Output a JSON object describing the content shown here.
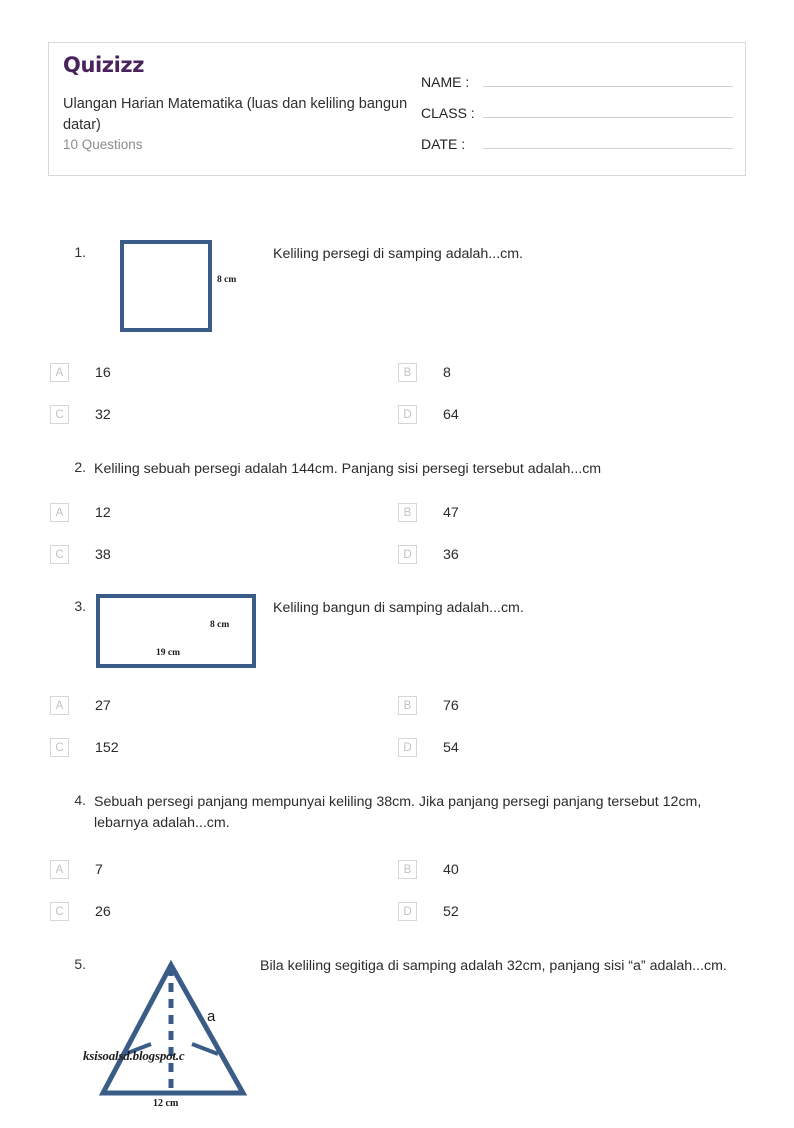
{
  "header": {
    "logo_text": "Quizizz",
    "quiz_title": "Ulangan Harian Matematika (luas dan keliling bangun datar)",
    "question_count": "10 Questions",
    "fields": [
      {
        "label": "NAME :",
        "value": ""
      },
      {
        "label": "CLASS :",
        "value": ""
      },
      {
        "label": "DATE  :",
        "value": ""
      }
    ]
  },
  "questions": [
    {
      "number": "1.",
      "text": "Keliling persegi di samping adalah...cm.",
      "figure": {
        "type": "square",
        "side_label": "8 cm"
      },
      "options": [
        {
          "letter": "A",
          "text": "16"
        },
        {
          "letter": "B",
          "text": "8"
        },
        {
          "letter": "C",
          "text": "32"
        },
        {
          "letter": "D",
          "text": "64"
        }
      ]
    },
    {
      "number": "2.",
      "text": "Keliling sebuah persegi adalah 144cm. Panjang sisi persegi tersebut adalah...cm",
      "figure": null,
      "options": [
        {
          "letter": "A",
          "text": "12"
        },
        {
          "letter": "B",
          "text": "47"
        },
        {
          "letter": "C",
          "text": "38"
        },
        {
          "letter": "D",
          "text": "36"
        }
      ]
    },
    {
      "number": "3.",
      "text": "Keliling bangun di samping adalah...cm.",
      "figure": {
        "type": "rectangle",
        "height_label": "8 cm",
        "width_label": "19 cm"
      },
      "options": [
        {
          "letter": "A",
          "text": "27"
        },
        {
          "letter": "B",
          "text": "76"
        },
        {
          "letter": "C",
          "text": "152"
        },
        {
          "letter": "D",
          "text": "54"
        }
      ]
    },
    {
      "number": "4.",
      "text": "Sebuah persegi panjang mempunyai keliling 38cm. Jika panjang persegi panjang tersebut 12cm, lebarnya adalah...cm.",
      "figure": null,
      "options": [
        {
          "letter": "A",
          "text": "7"
        },
        {
          "letter": "B",
          "text": "40"
        },
        {
          "letter": "C",
          "text": "26"
        },
        {
          "letter": "D",
          "text": "52"
        }
      ]
    },
    {
      "number": "5.",
      "text": "Bila keliling segitiga di samping adalah 32cm, panjang sisi “a” adalah...cm.",
      "figure": {
        "type": "isosceles-triangle",
        "side_label": "a",
        "base_label": "12 cm",
        "watermark": "ksisoalsd.blogspot.c"
      },
      "options": []
    }
  ],
  "colors": {
    "brand_purple": "#49245c",
    "figure_blue": "#3a5c87",
    "option_box_border": "#d6d6d6",
    "header_border": "#d8d8d8",
    "muted_text": "#8d8d8d"
  }
}
